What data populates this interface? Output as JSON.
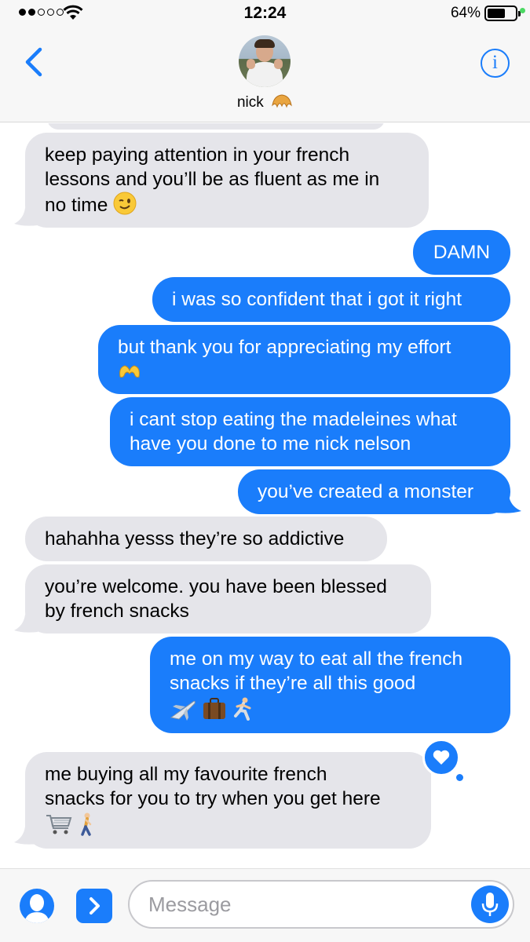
{
  "status_bar": {
    "time": "12:24",
    "battery_percent": "64%",
    "battery_level": 0.64,
    "signal_bars_filled": 2,
    "signal_bars_total": 5
  },
  "header": {
    "back_icon": "chevron-left-icon",
    "contact_name": "nick",
    "contact_emoji": "croissant",
    "info_label": "i"
  },
  "messages": [
    {
      "side": "in",
      "text_lines": [
        "keep paying attention in your french",
        "lessons and you’ll be as fluent as me in",
        "no time"
      ],
      "emoji": [
        "winking-face"
      ]
    },
    {
      "side": "out",
      "text_lines": [
        "DAMN"
      ],
      "emoji": []
    },
    {
      "side": "out",
      "text_lines": [
        "i was so confident that i got it right"
      ],
      "emoji": []
    },
    {
      "side": "out",
      "text_lines": [
        "but thank you for appreciating my effort"
      ],
      "emoji": [
        "heart-hands"
      ]
    },
    {
      "side": "out",
      "text_lines": [
        "i cant stop eating the madeleines what",
        "have you done to me nick nelson"
      ],
      "emoji": []
    },
    {
      "side": "out",
      "text_lines": [
        "you’ve created a monster"
      ],
      "emoji": []
    },
    {
      "side": "in",
      "text_lines": [
        "hahahha yesss they’re so addictive"
      ],
      "emoji": []
    },
    {
      "side": "in",
      "text_lines": [
        "you’re welcome. you have been blessed",
        "by french snacks"
      ],
      "emoji": []
    },
    {
      "side": "out",
      "text_lines": [
        "me on my way to eat all the french",
        "snacks if they’re all this good"
      ],
      "emoji": [
        "airplane",
        "suitcase",
        "running-person"
      ]
    },
    {
      "side": "in",
      "text_lines": [
        "me buying all my favourite french",
        "snacks for you to try when you get here"
      ],
      "emoji": [
        "shopping-cart",
        "walking-person"
      ],
      "reaction": "heart"
    }
  ],
  "input_bar": {
    "placeholder": "Message",
    "avatar_icon": "memoji-icon",
    "apps_icon": "app-store-chevron-icon",
    "mic_icon": "microphone-icon"
  },
  "colors": {
    "outgoing": "#1a7dfb",
    "incoming": "#e5e5ea",
    "accent": "#1a7dfb"
  }
}
